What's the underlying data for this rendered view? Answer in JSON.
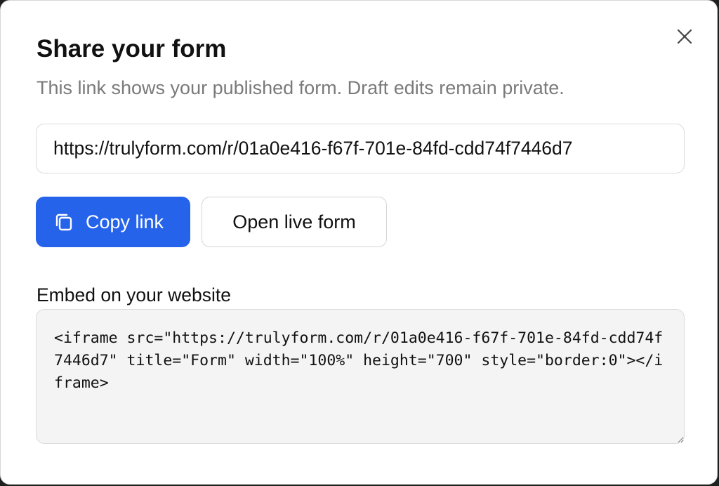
{
  "dialog": {
    "title": "Share your form",
    "subtitle": "This link shows your published form. Draft edits remain private.",
    "close_icon": "close-icon"
  },
  "share": {
    "url": "https://trulyform.com/r/01a0e416-f67f-701e-84fd-cdd74f7446d7",
    "copy_label": "Copy link",
    "copy_icon": "copy-icon",
    "open_label": "Open live form"
  },
  "embed": {
    "label": "Embed on your website",
    "code": "<iframe src=\"https://trulyform.com/r/01a0e416-f67f-701e-84fd-cdd74f7446d7\" title=\"Form\" width=\"100%\" height=\"700\" style=\"border:0\"></iframe>"
  },
  "colors": {
    "primary": "#2563eb",
    "muted_text": "#7a7a7a",
    "code_bg": "#f4f4f4"
  }
}
